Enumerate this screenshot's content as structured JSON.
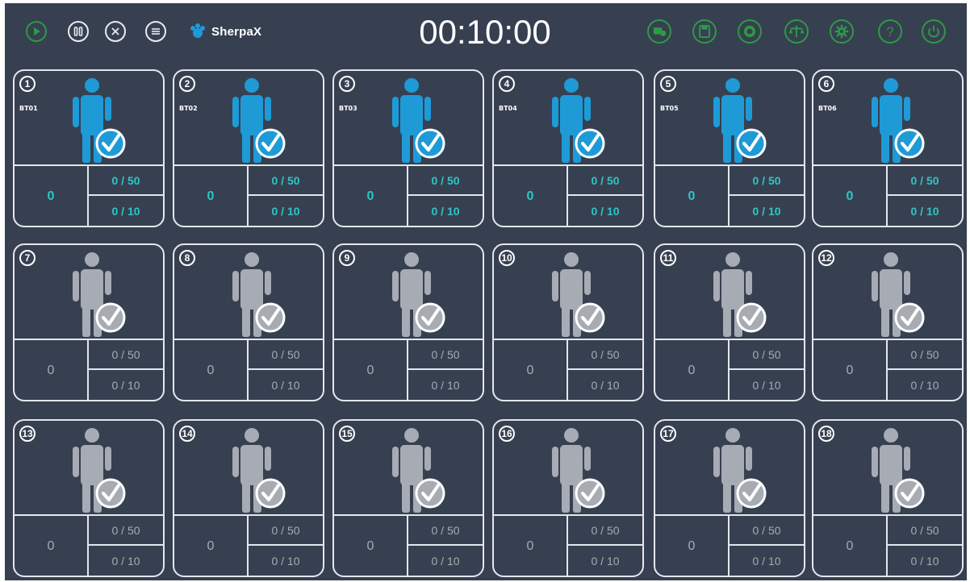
{
  "app": {
    "brand_name": "SherpaX",
    "timer": "00:10:00"
  },
  "toolbar_left": [
    {
      "name": "play-button",
      "icon": "play-icon",
      "color": "#2d9a45"
    },
    {
      "name": "pause-button",
      "icon": "pause-icon",
      "color": "#e8eaee"
    },
    {
      "name": "stop-button",
      "icon": "close-icon",
      "color": "#e8eaee"
    },
    {
      "name": "menu-button",
      "icon": "menu-icon",
      "color": "#e8eaee"
    }
  ],
  "toolbar_right": [
    {
      "name": "users-button",
      "icon": "users-icon"
    },
    {
      "name": "save-button",
      "icon": "save-icon"
    },
    {
      "name": "record-button",
      "icon": "record-icon"
    },
    {
      "name": "balance-button",
      "icon": "balance-icon"
    },
    {
      "name": "settings-button",
      "icon": "gear-icon"
    },
    {
      "name": "help-button",
      "icon": "help-icon"
    },
    {
      "name": "power-button",
      "icon": "power-icon"
    }
  ],
  "colors": {
    "background": "#374051",
    "active_figure": "#1e9bd7",
    "inactive_figure": "#a7abb3",
    "active_text": "#2fc5c4",
    "accent_green": "#2d9a45"
  },
  "stations": [
    {
      "number": "1",
      "code": "BT01",
      "active": true,
      "count": "0",
      "score1": "0 / 50",
      "score2": "0 / 10"
    },
    {
      "number": "2",
      "code": "BT02",
      "active": true,
      "count": "0",
      "score1": "0 / 50",
      "score2": "0 / 10"
    },
    {
      "number": "3",
      "code": "BT03",
      "active": true,
      "count": "0",
      "score1": "0 / 50",
      "score2": "0 / 10"
    },
    {
      "number": "4",
      "code": "BT04",
      "active": true,
      "count": "0",
      "score1": "0 / 50",
      "score2": "0 / 10"
    },
    {
      "number": "5",
      "code": "BT05",
      "active": true,
      "count": "0",
      "score1": "0 / 50",
      "score2": "0 / 10"
    },
    {
      "number": "6",
      "code": "BT06",
      "active": true,
      "count": "0",
      "score1": "0 / 50",
      "score2": "0 / 10"
    },
    {
      "number": "7",
      "code": "",
      "active": false,
      "count": "0",
      "score1": "0 / 50",
      "score2": "0 / 10"
    },
    {
      "number": "8",
      "code": "",
      "active": false,
      "count": "0",
      "score1": "0 / 50",
      "score2": "0 / 10"
    },
    {
      "number": "9",
      "code": "",
      "active": false,
      "count": "0",
      "score1": "0 / 50",
      "score2": "0 / 10"
    },
    {
      "number": "10",
      "code": "",
      "active": false,
      "count": "0",
      "score1": "0 / 50",
      "score2": "0 / 10"
    },
    {
      "number": "11",
      "code": "",
      "active": false,
      "count": "0",
      "score1": "0 / 50",
      "score2": "0 / 10"
    },
    {
      "number": "12",
      "code": "",
      "active": false,
      "count": "0",
      "score1": "0 / 50",
      "score2": "0 / 10"
    },
    {
      "number": "13",
      "code": "",
      "active": false,
      "count": "0",
      "score1": "0 / 50",
      "score2": "0 / 10"
    },
    {
      "number": "14",
      "code": "",
      "active": false,
      "count": "0",
      "score1": "0 / 50",
      "score2": "0 / 10"
    },
    {
      "number": "15",
      "code": "",
      "active": false,
      "count": "0",
      "score1": "0 / 50",
      "score2": "0 / 10"
    },
    {
      "number": "16",
      "code": "",
      "active": false,
      "count": "0",
      "score1": "0 / 50",
      "score2": "0 / 10"
    },
    {
      "number": "17",
      "code": "",
      "active": false,
      "count": "0",
      "score1": "0 / 50",
      "score2": "0 / 10"
    },
    {
      "number": "18",
      "code": "",
      "active": false,
      "count": "0",
      "score1": "0 / 50",
      "score2": "0 / 10"
    }
  ]
}
